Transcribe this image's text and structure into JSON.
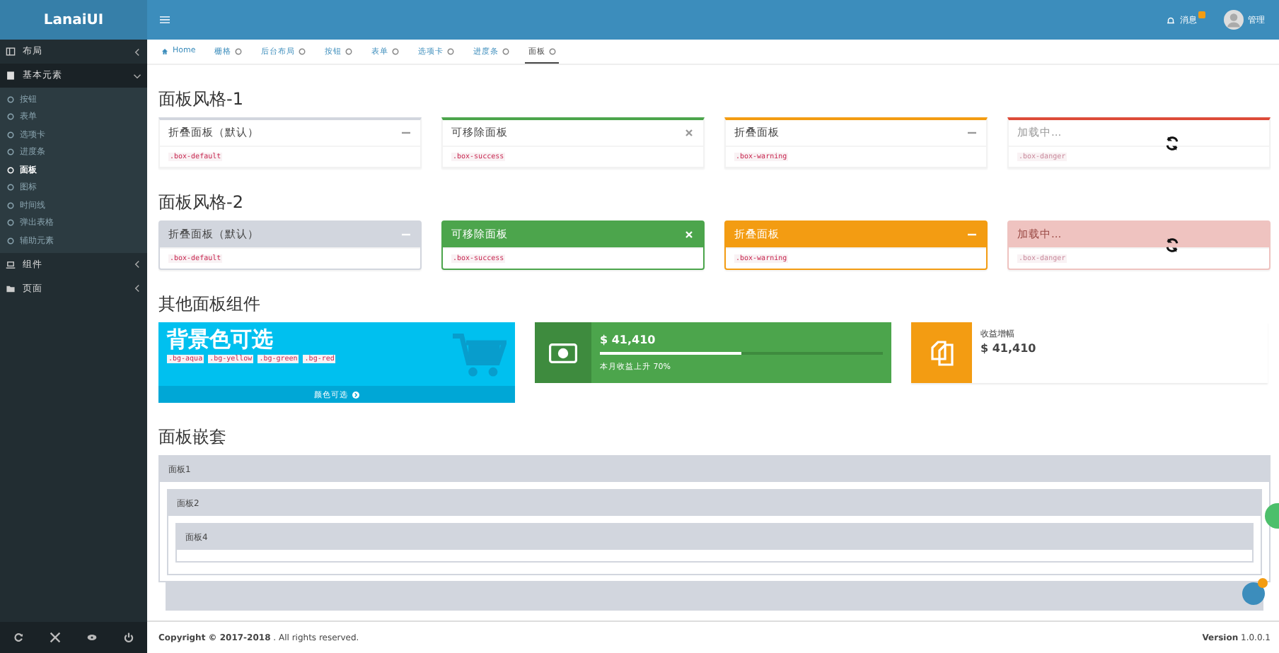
{
  "brand": "LanaiUI",
  "header": {
    "notice": "消息",
    "user": "管理"
  },
  "sidebar": [
    {
      "label": "布局",
      "expanded": false
    },
    {
      "label": "基本元素",
      "expanded": true,
      "children": [
        {
          "label": "按钮",
          "selected": false
        },
        {
          "label": "表单",
          "selected": false
        },
        {
          "label": "选项卡",
          "selected": false
        },
        {
          "label": "进度条",
          "selected": false
        },
        {
          "label": "面板",
          "selected": true
        },
        {
          "label": "图标",
          "selected": false
        },
        {
          "label": "时间线",
          "selected": false
        },
        {
          "label": "弹出表格",
          "selected": false
        },
        {
          "label": "辅助元素",
          "selected": false
        }
      ]
    },
    {
      "label": "组件",
      "expanded": false
    },
    {
      "label": "页面",
      "expanded": false
    }
  ],
  "tabs": [
    {
      "label": "Home",
      "selected": false,
      "kind": "home"
    },
    {
      "label": "栅格",
      "selected": false,
      "kind": "page"
    },
    {
      "label": "后台布局",
      "selected": false,
      "kind": "page"
    },
    {
      "label": "按钮",
      "selected": false,
      "kind": "page"
    },
    {
      "label": "表单",
      "selected": false,
      "kind": "page"
    },
    {
      "label": "选项卡",
      "selected": false,
      "kind": "page"
    },
    {
      "label": "进度条",
      "selected": false,
      "kind": "page"
    },
    {
      "label": "面板",
      "selected": true,
      "kind": "page"
    }
  ],
  "sections": [
    {
      "title": "面板风格-1",
      "solid": false,
      "panels": [
        {
          "title": "折叠面板（默认）",
          "code": ".box-default",
          "kind": "default",
          "removable": false,
          "loading": false
        },
        {
          "title": "可移除面板",
          "code": ".box-success",
          "kind": "success",
          "removable": true,
          "loading": false
        },
        {
          "title": "折叠面板",
          "code": ".box-warning",
          "kind": "warning",
          "removable": false,
          "loading": false
        },
        {
          "title": "加载中...",
          "code": ".box-danger",
          "kind": "danger",
          "loading": true
        }
      ]
    },
    {
      "title": "面板风格-2",
      "solid": true,
      "panels": [
        {
          "title": "折叠面板（默认）",
          "code": ".box-default",
          "kind": "default",
          "removable": false,
          "loading": false
        },
        {
          "title": "可移除面板",
          "code": ".box-success",
          "kind": "success",
          "removable": true,
          "loading": false
        },
        {
          "title": "折叠面板",
          "code": ".box-warning",
          "kind": "warning",
          "removable": false,
          "loading": false
        },
        {
          "title": "加载中...",
          "code": ".box-danger",
          "kind": "danger",
          "loading": true
        }
      ]
    }
  ],
  "widgets_title": "其他面板组件",
  "color_box": {
    "title": "背景色可选",
    "chips": [
      ".bg-aqua",
      ".bg-yellow",
      ".bg-green",
      ".bg-red"
    ],
    "footer": "颜色可选"
  },
  "progress_box": {
    "value": "$ 41,410",
    "level": 0.5,
    "description": "本月收益上升 70%"
  },
  "info_box": {
    "label": "收益增幅",
    "value": "$ 41,410"
  },
  "nested_title": "面板嵌套",
  "nested": [
    {
      "title": "面板1",
      "children": [
        {
          "title": "面板2",
          "children": [
            {
              "title": "面板4"
            }
          ]
        }
      ]
    }
  ],
  "footer": {
    "copyright": "Copyright © 2017-2018",
    "rights": ". All rights reserved.",
    "version_label": "Version",
    "version": "1.0.0.1"
  }
}
